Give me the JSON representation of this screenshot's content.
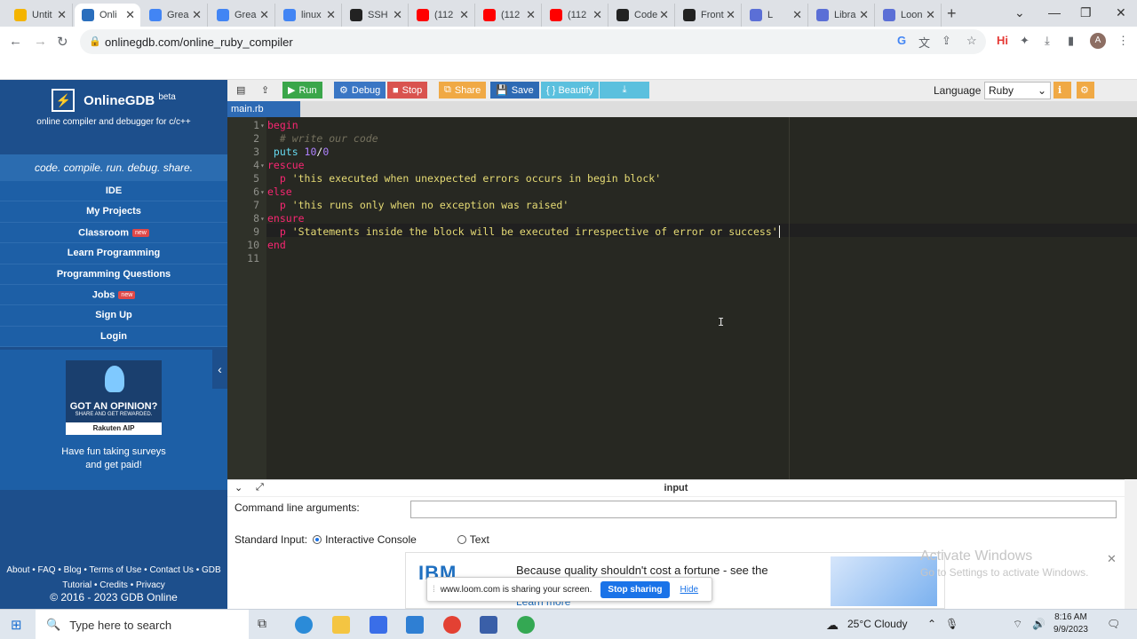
{
  "browser": {
    "tabs": [
      {
        "title": "Untit",
        "color": "#f4b400"
      },
      {
        "title": "Onli",
        "color": "#2a6ebd",
        "active": true
      },
      {
        "title": "Grea",
        "color": "#4285f4"
      },
      {
        "title": "Grea",
        "color": "#4285f4"
      },
      {
        "title": "linux",
        "color": "#4285f4"
      },
      {
        "title": "SSH",
        "color": "#222222"
      },
      {
        "title": "(112",
        "color": "#ff0000"
      },
      {
        "title": "(112",
        "color": "#ff0000"
      },
      {
        "title": "(112",
        "color": "#ff0000"
      },
      {
        "title": "Code",
        "color": "#222222"
      },
      {
        "title": "Front",
        "color": "#222222"
      },
      {
        "title": "L",
        "color": "#5b6fd6"
      },
      {
        "title": "Libra",
        "color": "#5b6fd6"
      },
      {
        "title": "Loon",
        "color": "#5b6fd6"
      }
    ],
    "new_tab": "+",
    "url": "onlinegdb.com/online_ruby_compiler",
    "profile_initial": "A",
    "hi_label": "Hi"
  },
  "sidebar": {
    "brand": "OnlineGDB",
    "brand_sup": "beta",
    "subtitle": "online compiler and debugger for c/c++",
    "tagline": "code. compile. run. debug. share.",
    "menu": [
      {
        "label": "IDE"
      },
      {
        "label": "My Projects"
      },
      {
        "label": "Classroom",
        "badge": "new"
      },
      {
        "label": "Learn Programming"
      },
      {
        "label": "Programming Questions"
      },
      {
        "label": "Jobs",
        "badge": "new"
      },
      {
        "label": "Sign Up"
      },
      {
        "label": "Login"
      }
    ],
    "ad": {
      "line1": "GOT AN OPINION?",
      "line2": "SHARE AND GET REWARDED.",
      "brand": "Rakuten AIP",
      "caption_1": "Have fun taking surveys",
      "caption_2": "and get paid!"
    },
    "footer_links_1": "About • FAQ • Blog • Terms of Use • Contact Us • GDB",
    "footer_links_2": "Tutorial • Credits • Privacy",
    "copyright": "© 2016 - 2023 GDB Online"
  },
  "toolbar": {
    "run": "Run",
    "debug": "Debug",
    "stop": "Stop",
    "share": "Share",
    "save": "Save",
    "beautify": "{ } Beautify",
    "language_label": "Language",
    "language_value": "Ruby",
    "colors": {
      "run": "#3aa64a",
      "debug": "#3a76c4",
      "stop": "#d9534f",
      "share": "#f0a945",
      "save": "#2d6ab4",
      "beautify": "#5bc0de"
    }
  },
  "editor": {
    "file_tab": "main.rb",
    "lines": [
      {
        "n": "1",
        "fold": "▾"
      },
      {
        "n": "2"
      },
      {
        "n": "3"
      },
      {
        "n": "4",
        "fold": "▾"
      },
      {
        "n": "5"
      },
      {
        "n": "6",
        "fold": "▾"
      },
      {
        "n": "7"
      },
      {
        "n": "8",
        "fold": "▾"
      },
      {
        "n": "9"
      },
      {
        "n": "10"
      },
      {
        "n": "11"
      }
    ],
    "code": {
      "l1": "begin",
      "l2": "  # write our code",
      "l3_a": " puts",
      "l3_b": " 10",
      "l3_c": "/",
      "l3_d": "0",
      "l4": "rescue",
      "l5_a": "  p ",
      "l5_b": "'this executed when unexpected errors occurs in begin block'",
      "l6": "else",
      "l7_a": "  p ",
      "l7_b": "'this runs only when no exception was raised'",
      "l8": "ensure",
      "l9_a": "  p ",
      "l9_b": "'Statements inside the block will be executed irrespective of error or success'",
      "l10": "end"
    }
  },
  "io": {
    "panel_title": "input",
    "cmd_label": "Command line arguments:",
    "stdin_label": "Standard Input:",
    "opt_interactive": "Interactive Console",
    "opt_text": "Text",
    "ad_brand": "IBM",
    "ad_text": "Because quality shouldn't cost a fortune - see the",
    "ad_more": "Learn more"
  },
  "share_popup": {
    "text": "www.loom.com is sharing your screen.",
    "stop": "Stop sharing",
    "hide": "Hide"
  },
  "watermark": {
    "line1": "Activate Windows",
    "line2": "Go to Settings to activate Windows."
  },
  "taskbar": {
    "search_placeholder": "Type here to search",
    "weather": "25°C  Cloudy",
    "time": "8:16 AM",
    "date": "9/9/2023"
  }
}
